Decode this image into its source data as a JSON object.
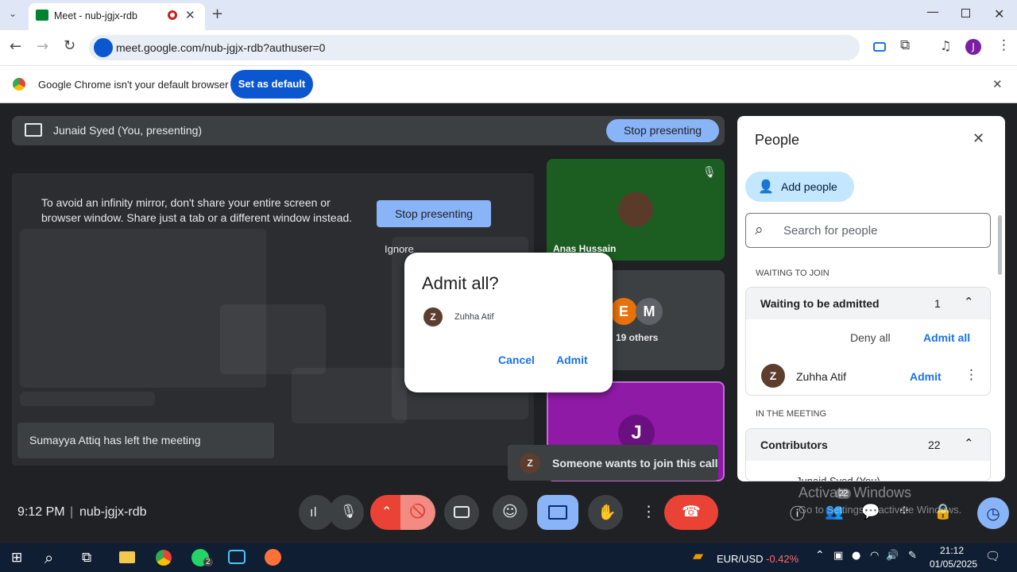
{
  "browser": {
    "tab_title": "Meet - nub-jgjx-rdb",
    "url": "meet.google.com/nub-jgjx-rdb?authuser=0",
    "infobar_text": "Google Chrome isn't your default browser",
    "infobar_button": "Set as default",
    "profile_initial": "J"
  },
  "meet": {
    "presenting_label": "Junaid Syed (You, presenting)",
    "stop_presenting": "Stop presenting",
    "warning": "To avoid an infinity mirror, don't share your entire screen or browser window. Share just a tab or a different window instead.",
    "stop_presenting_2": "Stop presenting",
    "ignore": "Ignore",
    "left_toast": "Sumayya Attiq has left the meeting",
    "tiles": {
      "anas_name": "Anas Hussain",
      "others_label": "19 others",
      "others_avatars": [
        "E",
        "M"
      ],
      "j_avatar": "J"
    },
    "dialog": {
      "title": "Admit all?",
      "person_initial": "Z",
      "person_name": "Zuhha Atif",
      "cancel": "Cancel",
      "admit": "Admit"
    },
    "join_toast": {
      "initial": "Z",
      "text": "Someone wants to join this call"
    },
    "time": "9:12 PM",
    "meeting_code": "nub-jgjx-rdb",
    "participant_count": "22"
  },
  "people_panel": {
    "title": "People",
    "add_people": "Add people",
    "search_placeholder": "Search for people",
    "waiting_section": "WAITING TO JOIN",
    "waiting_header": "Waiting to be admitted",
    "waiting_count": "1",
    "deny_all": "Deny all",
    "admit_all": "Admit all",
    "waiting_person_initial": "Z",
    "waiting_person": "Zuhha Atif",
    "admit": "Admit",
    "in_meeting_section": "IN THE MEETING",
    "contributors": "Contributors",
    "contributors_count": "22",
    "first_contributor": "Junaid Syed (You)"
  },
  "watermark": {
    "line1": "Activate Windows",
    "line2": "Go to Settings to activate Windows."
  },
  "taskbar": {
    "ticker_pair": "EUR/USD",
    "ticker_change": "-0.42%",
    "clock_time": "21:12",
    "clock_date": "01/05/2025",
    "whatsapp_badge": "2"
  },
  "colors": {
    "meet_bg": "#202124",
    "accent_blue": "#1a73e8",
    "stop_btn": "#8ab4f8",
    "end_call": "#ea4335",
    "camera_off": "#ea4335",
    "present_active": "#8ab4f8",
    "anas_tile": "#1c5e22",
    "j_tile": "#8f1aa6"
  }
}
